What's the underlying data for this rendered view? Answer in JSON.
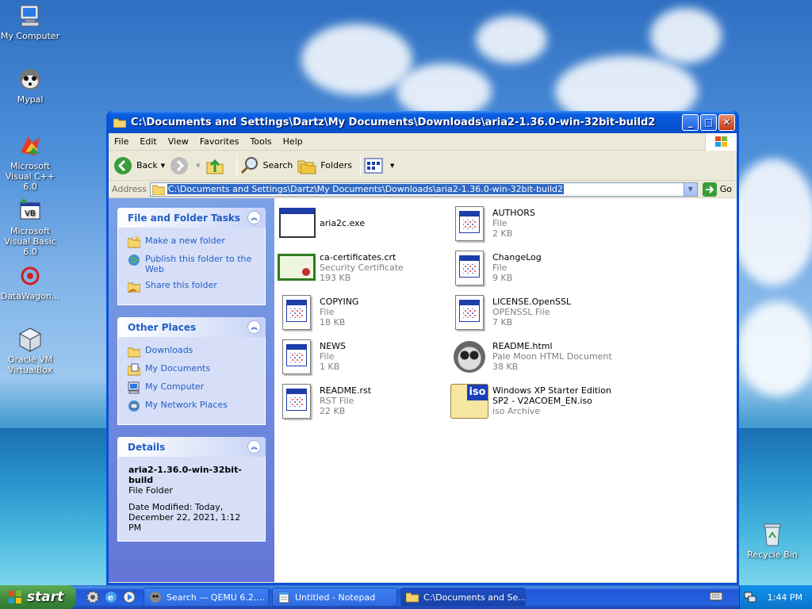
{
  "desktop": {
    "icons": [
      {
        "label": "My Computer"
      },
      {
        "label": "Mypal"
      },
      {
        "label": "Microsoft Visual C++ 6.0"
      },
      {
        "label": "Microsoft Visual Basic 6.0"
      },
      {
        "label": "DataWagon..."
      },
      {
        "label": "Oracle VM VirtualBox"
      },
      {
        "label": "Recycle Bin"
      }
    ]
  },
  "window": {
    "title": "C:\\Documents and Settings\\Dartz\\My Documents\\Downloads\\aria2-1.36.0-win-32bit-build2",
    "menu": [
      "File",
      "Edit",
      "View",
      "Favorites",
      "Tools",
      "Help"
    ],
    "toolbar": {
      "back": "Back",
      "search": "Search",
      "folders": "Folders"
    },
    "address": {
      "label": "Address",
      "value": "C:\\Documents and Settings\\Dartz\\My Documents\\Downloads\\aria2-1.36.0-win-32bit-build2",
      "go": "Go"
    }
  },
  "taskpane": {
    "file_tasks": {
      "title": "File and Folder Tasks",
      "items": [
        "Make a new folder",
        "Publish this folder to the Web",
        "Share this folder"
      ]
    },
    "other_places": {
      "title": "Other Places",
      "items": [
        "Downloads",
        "My Documents",
        "My Computer",
        "My Network Places"
      ]
    },
    "details": {
      "title": "Details",
      "name": "aria2-1.36.0-win-32bit-build",
      "type": "File Folder",
      "modified": "Date Modified: Today, December 22, 2021, 1:12 PM"
    }
  },
  "files": [
    {
      "name": "aria2c.exe",
      "type": "",
      "size": "",
      "icon": "exe-icon"
    },
    {
      "name": "AUTHORS",
      "type": "File",
      "size": "2 KB",
      "icon": "file-icon"
    },
    {
      "name": "ca-certificates.crt",
      "type": "Security Certificate",
      "size": "193 KB",
      "icon": "certificate-icon"
    },
    {
      "name": "ChangeLog",
      "type": "File",
      "size": "9 KB",
      "icon": "file-icon"
    },
    {
      "name": "COPYING",
      "type": "File",
      "size": "18 KB",
      "icon": "file-icon"
    },
    {
      "name": "LICENSE.OpenSSL",
      "type": "OPENSSL File",
      "size": "7 KB",
      "icon": "file-icon"
    },
    {
      "name": "NEWS",
      "type": "File",
      "size": "1 KB",
      "icon": "file-icon"
    },
    {
      "name": "README.html",
      "type": "Pale Moon HTML Document",
      "size": "38 KB",
      "icon": "palemoon-icon"
    },
    {
      "name": "README.rst",
      "type": "RST File",
      "size": "22 KB",
      "icon": "file-icon"
    },
    {
      "name": "Windows XP Starter Edition SP2 - V2ACOEM_EN.iso",
      "type": "iso Archive",
      "size": "",
      "icon": "iso-icon"
    }
  ],
  "taskbar": {
    "start": "start",
    "tasks": [
      {
        "label": "Search — QEMU 6.2...."
      },
      {
        "label": "Untitled - Notepad"
      },
      {
        "label": "C:\\Documents and Se..."
      }
    ],
    "clock": "1:44 PM"
  },
  "colors": {
    "title_blue": "#0a53d6",
    "link_blue": "#215dc6",
    "selection": "#316ac5",
    "start_green": "#3c873c"
  }
}
